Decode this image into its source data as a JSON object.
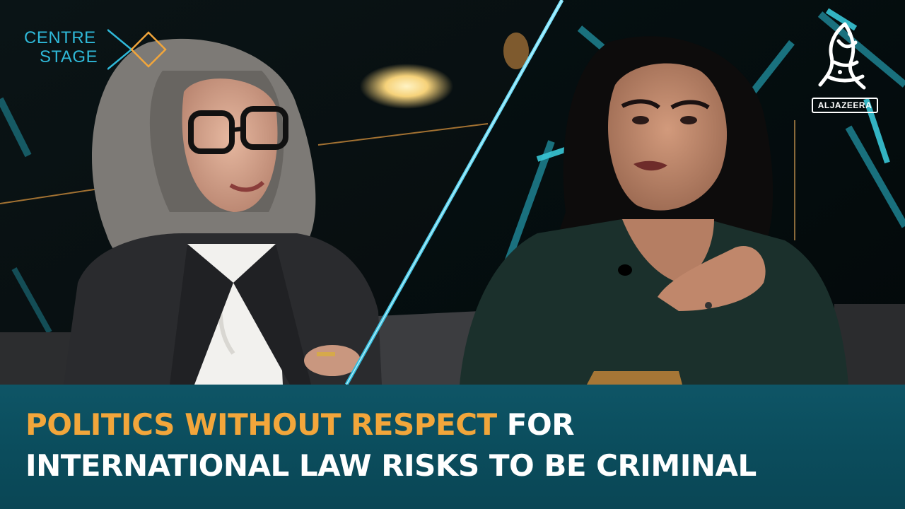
{
  "brand": {
    "show_logo_line1": "CENTRE",
    "show_logo_line2": "STAGE",
    "network_badge": "ALJAZEERA"
  },
  "headline": {
    "highlight": "POLITICS WITHOUT RESPECT",
    "line1_rest": " FOR",
    "line2": "INTERNATIONAL LAW RISKS TO BE CRIMINAL"
  },
  "colors": {
    "highlight": "#f2a63b",
    "headline_text": "#ffffff",
    "banner_bg": "#0c5162",
    "logo_cyan": "#2fb8d8",
    "logo_orange": "#f2a63b"
  }
}
